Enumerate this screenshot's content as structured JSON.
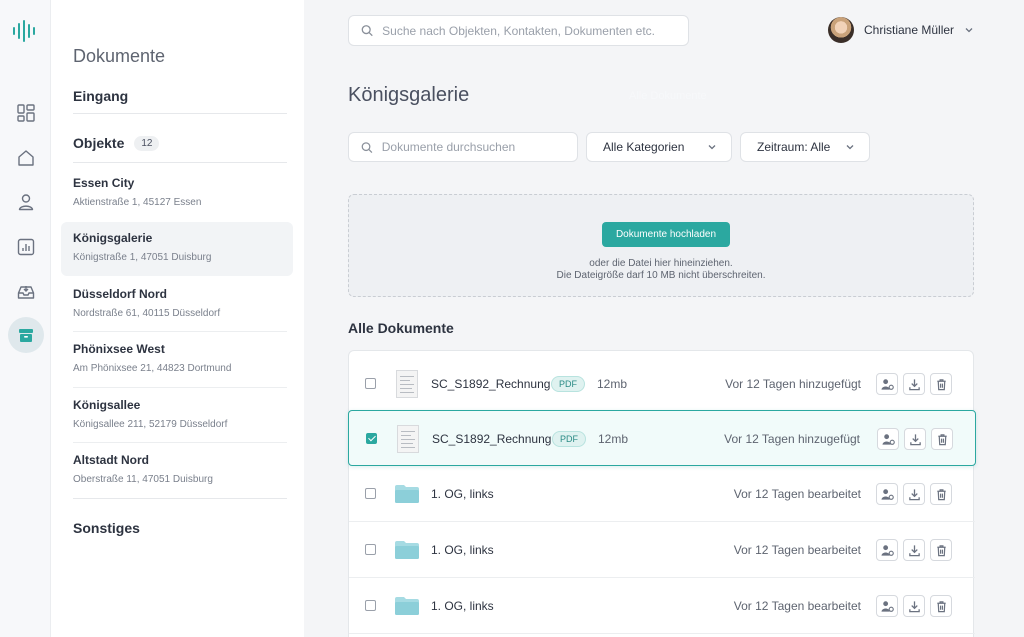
{
  "app": {
    "accent_color": "#2ba8a0"
  },
  "rail": {
    "items": [
      {
        "icon": "dashboard-icon"
      },
      {
        "icon": "home-icon"
      },
      {
        "icon": "person-icon"
      },
      {
        "icon": "chart-icon"
      },
      {
        "icon": "inbox-icon"
      },
      {
        "icon": "archive-icon",
        "active": true
      }
    ]
  },
  "sidebar": {
    "title": "Dokumente",
    "inbox_label": "Eingang",
    "objects_label": "Objekte",
    "objects_count": "12",
    "objects": [
      {
        "name": "Essen City",
        "address": "Aktienstraße 1, 45127 Essen"
      },
      {
        "name": "Königsgalerie",
        "address": "Königstraße 1, 47051 Duisburg",
        "active": true
      },
      {
        "name": "Düsseldorf Nord",
        "address": "Nordstraße 61, 40115 Düsseldorf"
      },
      {
        "name": "Phönixsee West",
        "address": "Am Phönixsee 21, 44823 Dortmund"
      },
      {
        "name": "Königsallee",
        "address": "Königsallee 211, 52179 Düsseldorf"
      },
      {
        "name": "Altstadt Nord",
        "address": "Oberstraße 11, 47051 Duisburg"
      }
    ],
    "other_label": "Sonstiges"
  },
  "header": {
    "search_placeholder": "Suche nach Objekten, Kontakten, Dokumenten etc.",
    "user_name": "Christiane Müller"
  },
  "main": {
    "title": "Königsgalerie",
    "ghost_label": "Alle Dokumente",
    "doc_search_placeholder": "Dokumente durchsuchen",
    "category_select": "Alle Kategorien",
    "period_select": "Zeitraum: Alle",
    "upload": {
      "button": "Dokumente hochladen",
      "hint_line1": "oder die Datei hier hineinziehen.",
      "hint_line2": "Die Dateigröße darf 10 MB nicht überschreiten."
    },
    "list_title": "Alle Dokumente",
    "files": [
      {
        "name": "SC_S1892_Rechnung",
        "kind": "doc",
        "badge": "PDF",
        "size": "12mb",
        "date": "Vor 12 Tagen hinzugefügt",
        "checked": false,
        "selected": false
      },
      {
        "name": "SC_S1892_Rechnung",
        "kind": "doc",
        "badge": "PDF",
        "size": "12mb",
        "date": "Vor 12 Tagen hinzugefügt",
        "checked": true,
        "selected": true
      },
      {
        "name": "1. OG, links",
        "kind": "folder",
        "date": "Vor 12 Tagen bearbeitet",
        "checked": false,
        "selected": false
      },
      {
        "name": "1. OG, links",
        "kind": "folder",
        "date": "Vor 12 Tagen bearbeitet",
        "checked": false,
        "selected": false
      },
      {
        "name": "1. OG, links",
        "kind": "folder",
        "date": "Vor 12 Tagen bearbeitet",
        "checked": false,
        "selected": false
      }
    ]
  }
}
